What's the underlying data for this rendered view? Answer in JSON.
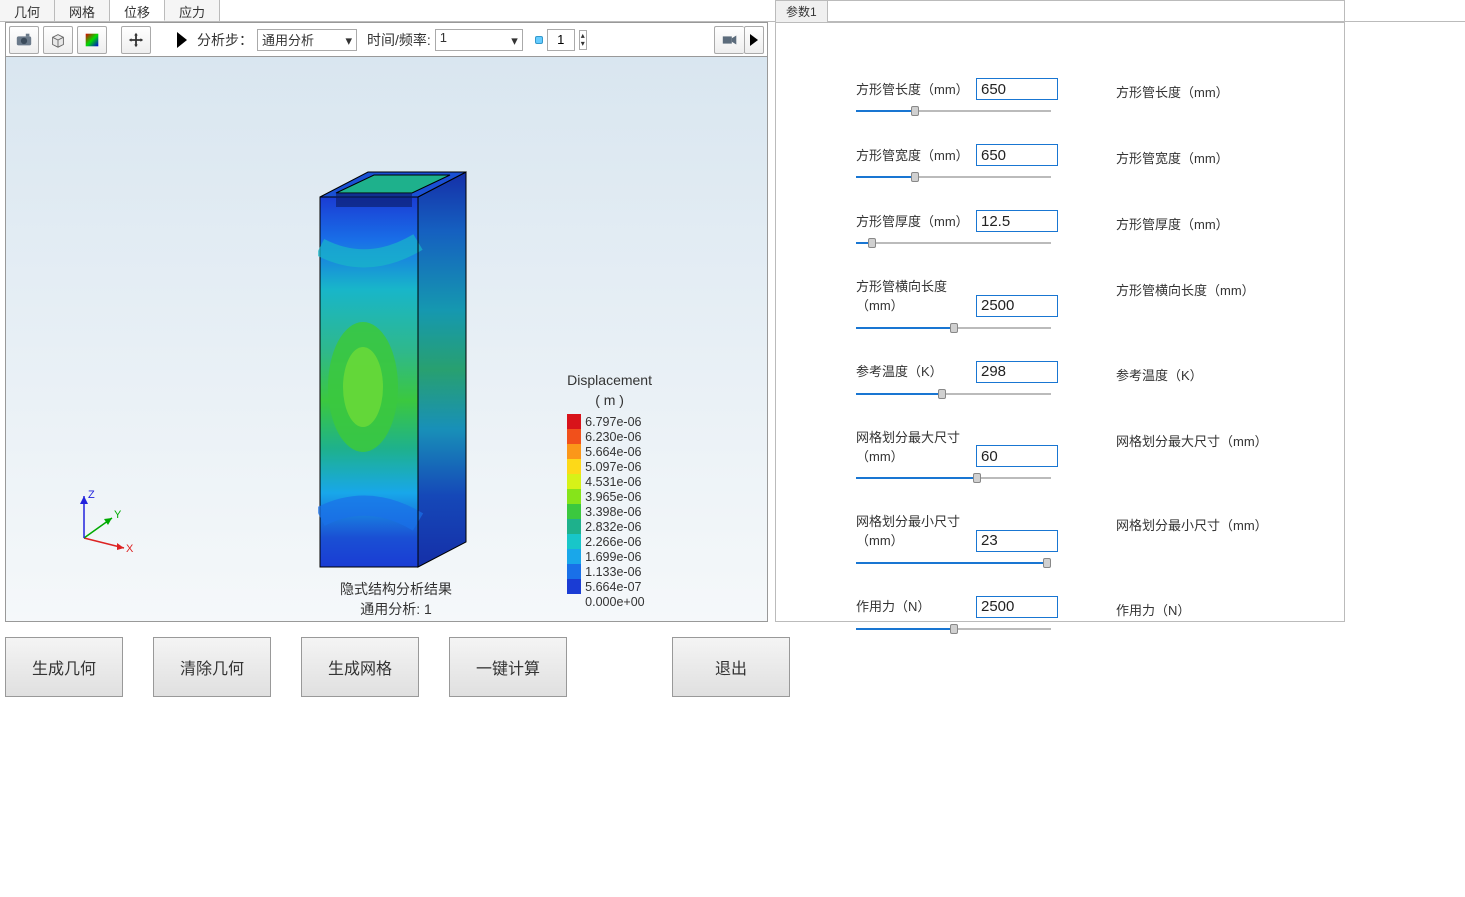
{
  "tabs": [
    "几何",
    "网格",
    "位移",
    "应力"
  ],
  "active_tab_index": 2,
  "toolbar": {
    "step_label": "分析步：",
    "step_value": "通用分析",
    "time_label": "时间/频率:",
    "time_value": "1",
    "counter": "1"
  },
  "legend": {
    "title": "Displacement",
    "unit": "( m )",
    "items": [
      {
        "color": "#d8131a",
        "v": "6.797e-06"
      },
      {
        "color": "#f1501b",
        "v": "6.230e-06"
      },
      {
        "color": "#fb9719",
        "v": "5.664e-06"
      },
      {
        "color": "#fdd918",
        "v": "5.097e-06"
      },
      {
        "color": "#d6f218",
        "v": "4.531e-06"
      },
      {
        "color": "#86e41a",
        "v": "3.965e-06"
      },
      {
        "color": "#3bc83f",
        "v": "3.398e-06"
      },
      {
        "color": "#1eb18c",
        "v": "2.832e-06"
      },
      {
        "color": "#18c6c9",
        "v": "2.266e-06"
      },
      {
        "color": "#19a7ea",
        "v": "1.699e-06"
      },
      {
        "color": "#1970e8",
        "v": "1.133e-06"
      },
      {
        "color": "#1a3cd4",
        "v": "5.664e-07"
      },
      {
        "color": "",
        "v": "0.000e+00"
      }
    ]
  },
  "caption": {
    "l1": "隐式结构分析结果",
    "l2": "通用分析: 1"
  },
  "right_tab": "参数1",
  "params": [
    {
      "label": "方形管长度（mm）",
      "value": "650",
      "pct": 30,
      "right": "方形管长度（mm）"
    },
    {
      "label": "方形管宽度（mm）",
      "value": "650",
      "pct": 30,
      "right": "方形管宽度（mm）"
    },
    {
      "label": "方形管厚度（mm）",
      "value": "12.5",
      "pct": 8,
      "right": "方形管厚度（mm）"
    },
    {
      "label": "方形管横向长度（mm）",
      "value": "2500",
      "pct": 50,
      "right": "方形管横向长度（mm）"
    },
    {
      "label": "参考温度（K）",
      "value": "298",
      "pct": 44,
      "right": "参考温度（K）"
    },
    {
      "label": "网格划分最大尺寸（mm）",
      "value": "60",
      "pct": 62,
      "right": "网格划分最大尺寸（mm）"
    },
    {
      "label": "网格划分最小尺寸（mm）",
      "value": "23",
      "pct": 98,
      "right": "网格划分最小尺寸（mm）"
    },
    {
      "label": "作用力（N）",
      "value": "2500",
      "pct": 50,
      "right": "作用力（N）"
    }
  ],
  "buttons": [
    "生成几何",
    "清除几何",
    "生成网格",
    "一键计算",
    "退出"
  ],
  "axis": {
    "x": "X",
    "y": "Y",
    "z": "Z"
  },
  "chart_data": {
    "type": "3d-contour",
    "quantity": "Displacement (m)",
    "range": [
      0.0,
      6.797e-06
    ],
    "colormap_levels": [
      0.0,
      5.664e-07,
      1.133e-06,
      1.699e-06,
      2.266e-06,
      2.832e-06,
      3.398e-06,
      3.965e-06,
      4.531e-06,
      5.097e-06,
      5.664e-06,
      6.23e-06,
      6.797e-06
    ],
    "geometry": "hollow square tube, isometric view",
    "analysis": "隐式结构分析 / 通用分析 step 1"
  }
}
